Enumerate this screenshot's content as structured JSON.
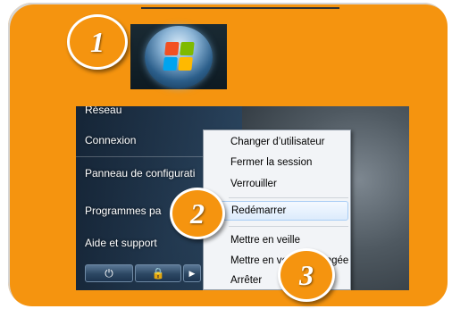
{
  "steps": [
    "1",
    "2",
    "3"
  ],
  "start_menu": {
    "items": [
      "Réseau",
      "Connexion",
      "Panneau de configurati",
      "Programmes pa",
      "Aide et support"
    ],
    "power_icon": "power-icon",
    "lock_icon": "lock-icon",
    "arrow_icon": "triangle-right-icon"
  },
  "shutdown_menu": {
    "items": [
      "Changer d’utilisateur",
      "Fermer la session",
      "Verrouiller",
      "Redémarrer",
      "Mettre en veille",
      "Mettre en veille prolongée",
      "Arrêter"
    ],
    "highlighted": "Redémarrer"
  },
  "colors": {
    "panel": "#f5940f",
    "flag_red": "#f25022",
    "flag_green": "#7fba00",
    "flag_blue": "#00a4ef",
    "flag_yellow": "#ffb900"
  }
}
